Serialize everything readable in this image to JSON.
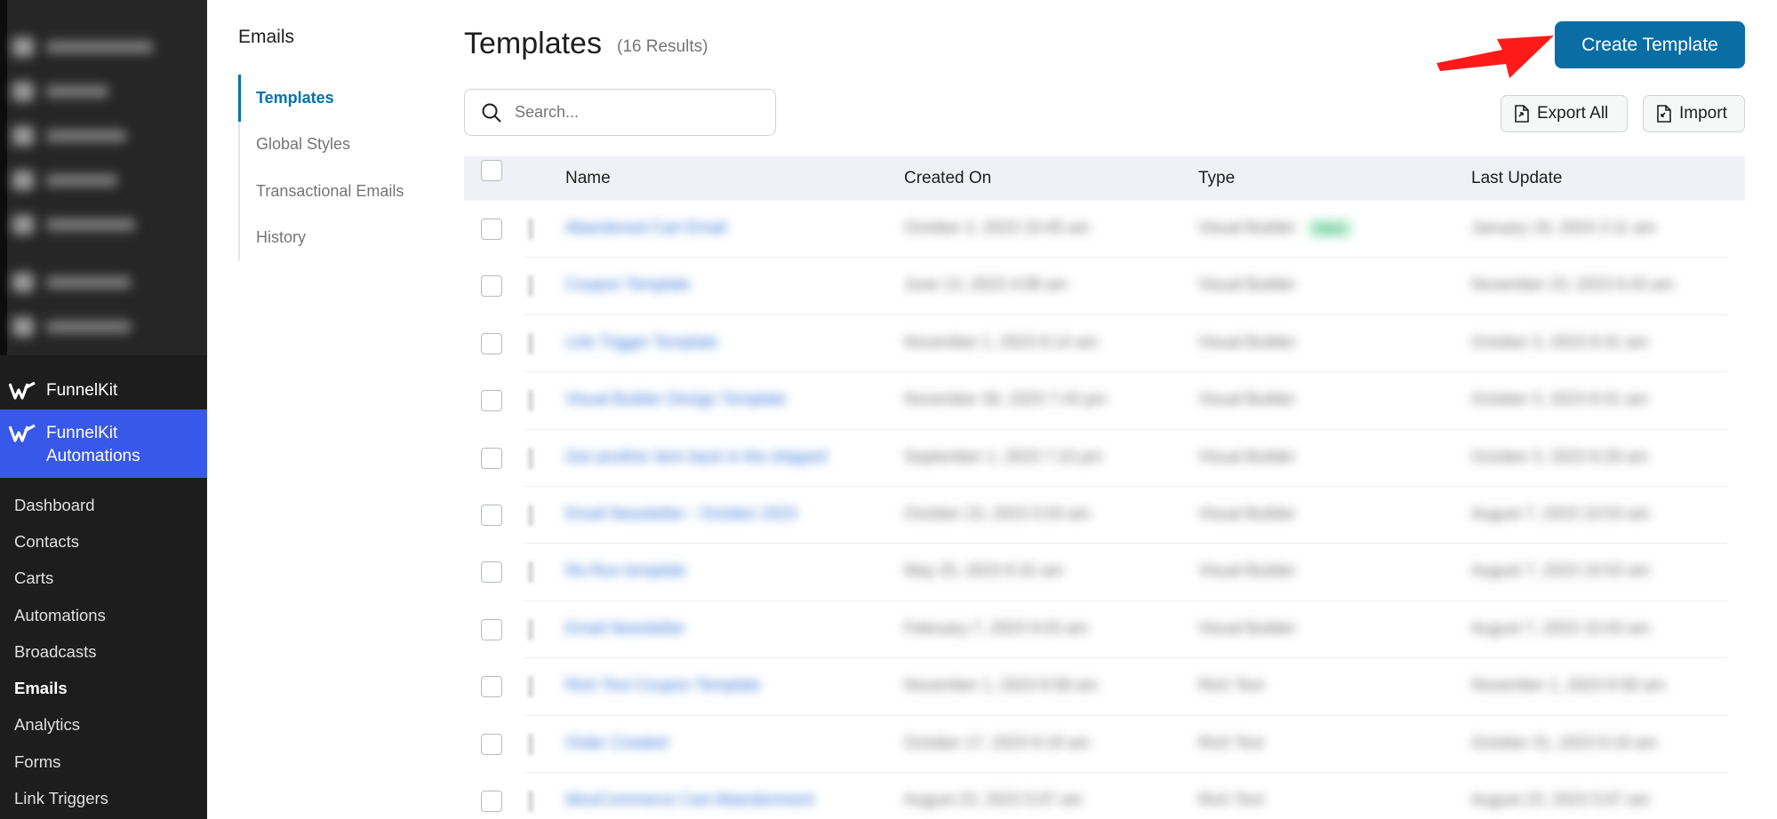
{
  "sidebar": {
    "funnelkit_label": "FunnelKit",
    "automations_label": "FunnelKit Automations",
    "sub_items": [
      {
        "label": "Dashboard",
        "active": false
      },
      {
        "label": "Contacts",
        "active": false
      },
      {
        "label": "Carts",
        "active": false
      },
      {
        "label": "Automations",
        "active": false
      },
      {
        "label": "Broadcasts",
        "active": false
      },
      {
        "label": "Emails",
        "active": true
      },
      {
        "label": "Analytics",
        "active": false
      },
      {
        "label": "Forms",
        "active": false
      },
      {
        "label": "Link Triggers",
        "active": false
      }
    ]
  },
  "secondary_nav": {
    "heading": "Emails",
    "items": [
      {
        "label": "Templates",
        "active": true
      },
      {
        "label": "Global Styles",
        "active": false
      },
      {
        "label": "Transactional Emails",
        "active": false
      },
      {
        "label": "History",
        "active": false
      }
    ]
  },
  "header": {
    "title": "Templates",
    "result_count": "(16 Results)",
    "create_button": "Create Template"
  },
  "search": {
    "placeholder": "Search..."
  },
  "toolbar": {
    "export_label": "Export All",
    "import_label": "Import"
  },
  "table": {
    "columns": [
      "Name",
      "Created On",
      "Type",
      "Last Update"
    ],
    "rows": [
      {
        "name": "Abandoned Cart Email",
        "created": "October 2, 2023 10:45 am",
        "type": "Visual Builder",
        "badge": "New",
        "update": "January 18, 2024 2:11 am"
      },
      {
        "name": "Coupon Template",
        "created": "June 13, 2023 4:08 am",
        "type": "Visual Builder",
        "update": "November 23, 2023 6:43 am"
      },
      {
        "name": "Link Trigger Template",
        "created": "November 1, 2023 6:14 am",
        "type": "Visual Builder",
        "update": "October 3, 2023 8:31 am"
      },
      {
        "name": "Visual Builder Design Template",
        "created": "November 30, 2023 7:43 pm",
        "type": "Visual Builder",
        "update": "October 3, 2023 8:31 am"
      },
      {
        "name": "Get another item back in the shipped",
        "created": "September 1, 2023 7:10 pm",
        "type": "Visual Builder",
        "update": "October 3, 2023 8:29 am"
      },
      {
        "name": "Email Newsletter - October 2023",
        "created": "October 23, 2023 5:03 am",
        "type": "Visual Builder",
        "update": "August 7, 2023 10:53 am"
      },
      {
        "name": "Re-Run template",
        "created": "May 25, 2023 6:32 am",
        "type": "Visual Builder",
        "update": "August 7, 2023 10:53 am"
      },
      {
        "name": "Email Newsletter",
        "created": "February 7, 2023 9:03 am",
        "type": "Visual Builder",
        "update": "August 7, 2023 10:43 am"
      },
      {
        "name": "Rich Text Coupon Template",
        "created": "November 1, 2023 6:58 am",
        "type": "Rich Text",
        "update": "November 1, 2023 6:58 am"
      },
      {
        "name": "Order Created",
        "created": "October 17, 2023 6:19 am",
        "type": "Rich Text",
        "update": "October 31, 2023 6:19 am"
      },
      {
        "name": "WooCommerce Cart Abandonment",
        "created": "August 23, 2023 5:07 am",
        "type": "Rich Text",
        "update": "August 23, 2023 5:07 am"
      }
    ]
  },
  "colors": {
    "accent": "#0a6ea5",
    "active_nav": "#0073aa",
    "wp_highlight": "#3858e9",
    "admin_bg": "#1d1d1d",
    "arrow": "#ff1a1a"
  }
}
